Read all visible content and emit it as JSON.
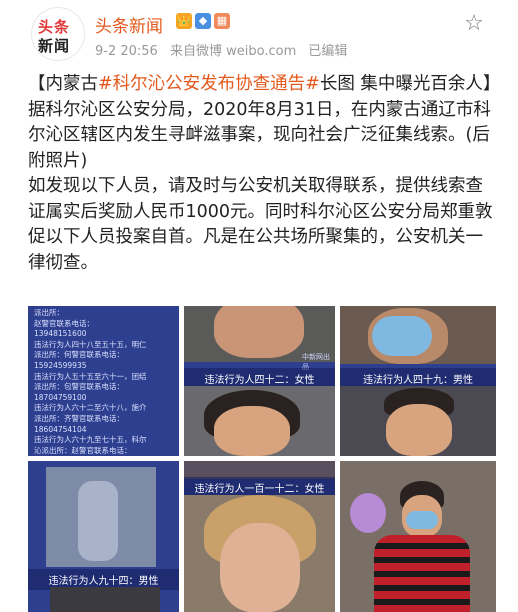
{
  "post": {
    "account_name": "头条新闻",
    "avatar_line1": "头条",
    "avatar_line2": "新闻",
    "badges": [
      "👑",
      "◆",
      "▦"
    ],
    "date": "9-2 20:56",
    "source": "来自微博 weibo.com",
    "edited": "已编辑",
    "text_prefix": "【内蒙古",
    "tag1": "#科尔沁公安发布协查通告#",
    "text_mid": "长图 集中曝光百余人】据科尔沁区公安分局，2020年8月31日，在内蒙古通辽市科尔沁区辖区内发生寻衅滋事案，现向社会广泛征集线索。(后附照片)",
    "text_para2": "如发现以下人员，请及时与公安机关取得联系，提供线索查证属实后奖励人民币1000元。同时科尔沁区公安分局郑重敦促以下人员投案自首。凡是在公共场所聚集的，公安机关一律彻查。"
  },
  "images": {
    "records": [
      "派出所：",
      "赵警官联系电话：",
      "13948151600",
      "违法行为人四十八至五十五，明仁",
      "派出所：何警官联系电话：",
      "15924599935",
      "违法行为人五十五至六十一，团结",
      "派出所：包警官联系电话：",
      "18704759100",
      "违法行为人六十二至六十八，施介",
      "派出所：齐警官联系电话：",
      "18604754104",
      "违法行为人六十九至七十五，科尔",
      "沁派出所：赵警官联系电话：",
      "13948549420"
    ],
    "caption_t2": "违法行为人四十二：女性",
    "caption_t3": "违法行为人四十九：男性",
    "caption_t4": "违法行为人九十四：男性",
    "caption_t5": "违法行为人一百一十二：女性",
    "watermark": "中新网出品"
  }
}
